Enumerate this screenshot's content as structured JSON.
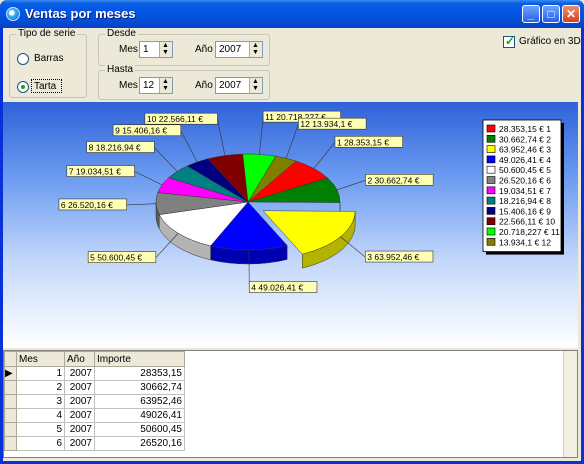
{
  "window": {
    "title": "Ventas por meses",
    "buttons": [
      "minimize",
      "maximize",
      "close"
    ]
  },
  "tipo_serie": {
    "label": "Tipo de serie",
    "options": [
      {
        "label": "Barras",
        "selected": false
      },
      {
        "label": "Tarta",
        "selected": true
      }
    ]
  },
  "desde": {
    "label": "Desde",
    "mes_label": "Mes",
    "mes": "1",
    "anio_label": "Año",
    "anio": "2007"
  },
  "hasta": {
    "label": "Hasta",
    "mes_label": "Mes",
    "mes": "12",
    "anio_label": "Año",
    "anio": "2007"
  },
  "grafico3d": {
    "label": "Gráfico en 3D",
    "checked": true
  },
  "chart_data": {
    "type": "pie",
    "three_d": true,
    "exploded_slice": 3,
    "slices": [
      {
        "month": 1,
        "value": 28353.15,
        "label": "1 28.353,15 €",
        "legend": "28.353,15 € 1",
        "color": "#ff0000"
      },
      {
        "month": 2,
        "value": 30662.74,
        "label": "2 30.662,74 €",
        "legend": "30.662,74 € 2",
        "color": "#008000"
      },
      {
        "month": 3,
        "value": 63952.46,
        "label": "3 63.952,46 €",
        "legend": "63.952,46 € 3",
        "color": "#ffff00"
      },
      {
        "month": 4,
        "value": 49026.41,
        "label": "4 49.026,41 €",
        "legend": "49.026,41 € 4",
        "color": "#0000ff"
      },
      {
        "month": 5,
        "value": 50600.45,
        "label": "5 50.600,45 €",
        "legend": "50.600,45 € 5",
        "color": "#ffffff"
      },
      {
        "month": 6,
        "value": 26520.16,
        "label": "6 26.520,16 €",
        "legend": "26.520,16 € 6",
        "color": "#808080"
      },
      {
        "month": 7,
        "value": 19034.51,
        "label": "7 19.034,51 €",
        "legend": "19.034,51 € 7",
        "color": "#ff00ff"
      },
      {
        "month": 8,
        "value": 18216.94,
        "label": "8 18.216,94 €",
        "legend": "18.216,94 € 8",
        "color": "#008080"
      },
      {
        "month": 9,
        "value": 15406.16,
        "label": "9 15.406,16 €",
        "legend": "15.406,16 € 9",
        "color": "#000080"
      },
      {
        "month": 10,
        "value": 22566.11,
        "label": "10 22.566,11 €",
        "legend": "22.566,11 € 10",
        "color": "#800000"
      },
      {
        "month": 11,
        "value": 20718.227,
        "label": "11 20.718,227 €",
        "legend": "20.718,227 € 11",
        "color": "#00ff00"
      },
      {
        "month": 12,
        "value": 13934.1,
        "label": "12 13.934,1 €",
        "legend": "13.934,1 € 12",
        "color": "#808000"
      }
    ],
    "legend_position": "top-right"
  },
  "grid": {
    "columns": [
      "Mes",
      "Año",
      "Importe"
    ],
    "rows": [
      {
        "mes": "1",
        "anio": "2007",
        "importe": "28353,15"
      },
      {
        "mes": "2",
        "anio": "2007",
        "importe": "30662,74"
      },
      {
        "mes": "3",
        "anio": "2007",
        "importe": "63952,46"
      },
      {
        "mes": "4",
        "anio": "2007",
        "importe": "49026,41"
      },
      {
        "mes": "5",
        "anio": "2007",
        "importe": "50600,45"
      },
      {
        "mes": "6",
        "anio": "2007",
        "importe": "26520,16"
      }
    ],
    "current_row": 0
  }
}
